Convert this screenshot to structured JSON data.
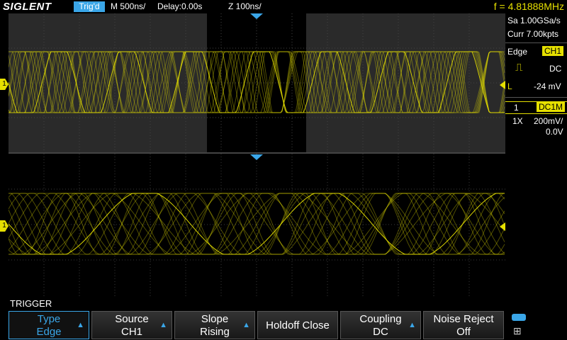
{
  "header": {
    "brand": "SIGLENT",
    "trigger_status": "Trig'd",
    "main_timebase": "M 500ns/",
    "delay": "Delay:0.00s",
    "zoom_timebase": "Z 100ns/",
    "frequency": "f = 4.81888MHz"
  },
  "acquisition": {
    "sample_rate": "Sa 1.00GSa/s",
    "memory_depth": "Curr 7.00kpts"
  },
  "trigger_info": {
    "type": "Edge",
    "source": "CH1",
    "coupling": "DC",
    "level_label": "L",
    "level": "-24 mV"
  },
  "channel": {
    "number": "1",
    "impedance": "DC1M",
    "probe": "1X",
    "scale": "200mV/",
    "offset": "0.0V"
  },
  "channel_marker": "1",
  "menu": {
    "title": "TRIGGER",
    "items": [
      {
        "label": "Type",
        "value": "Edge"
      },
      {
        "label": "Source",
        "value": "CH1"
      },
      {
        "label": "Slope",
        "value": "Rising"
      },
      {
        "label": "Holdoff Close",
        "value": ""
      },
      {
        "label": "Coupling",
        "value": "DC"
      },
      {
        "label": "Noise Reject",
        "value": "Off"
      }
    ]
  },
  "colors": {
    "trace": "#e6e000",
    "accent": "#3aa6e8",
    "grid": "#3a3a3a"
  }
}
